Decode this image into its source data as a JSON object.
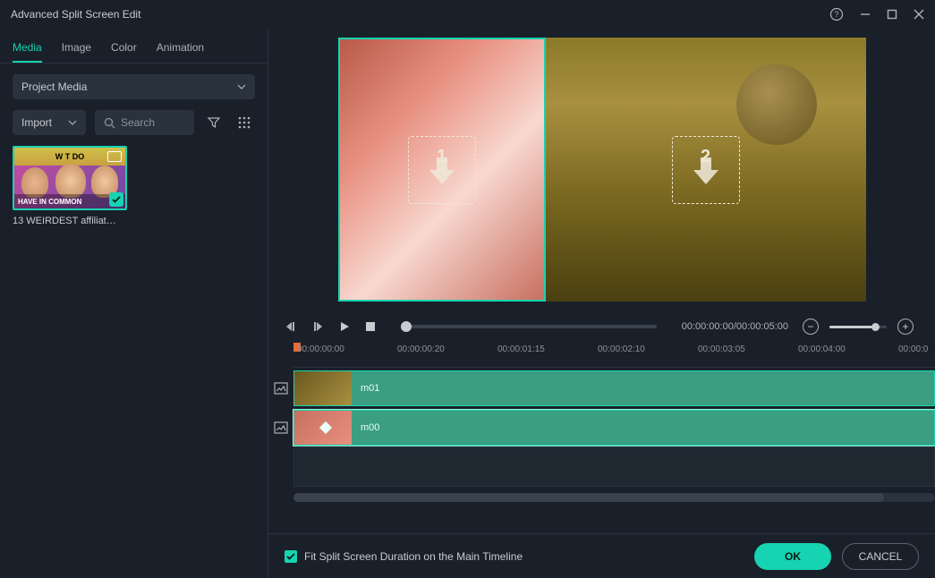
{
  "window": {
    "title": "Advanced Split Screen Edit"
  },
  "tabs": [
    "Media",
    "Image",
    "Color",
    "Animation"
  ],
  "activeTab": 0,
  "projectSelect": "Project Media",
  "importLabel": "Import",
  "searchPlaceholder": "Search",
  "mediaItem": {
    "topText": "W    T DO",
    "bottomText": "HAVE IN COMMON",
    "caption": "13 WEIRDEST affiliate mar..."
  },
  "dropNumbers": [
    "1",
    "2"
  ],
  "timecode": "00:00:00:00/00:00:05:00",
  "rulerLabels": [
    "00:00:00:00",
    "00:00:00:20",
    "00:00:01:15",
    "00:00:02:10",
    "00:00:03:05",
    "00:00:04:00",
    "00:00:0"
  ],
  "clips": [
    {
      "label": "m01"
    },
    {
      "label": "m00"
    }
  ],
  "fitLabel": "Fit Split Screen Duration on the Main Timeline",
  "okLabel": "OK",
  "cancelLabel": "CANCEL"
}
